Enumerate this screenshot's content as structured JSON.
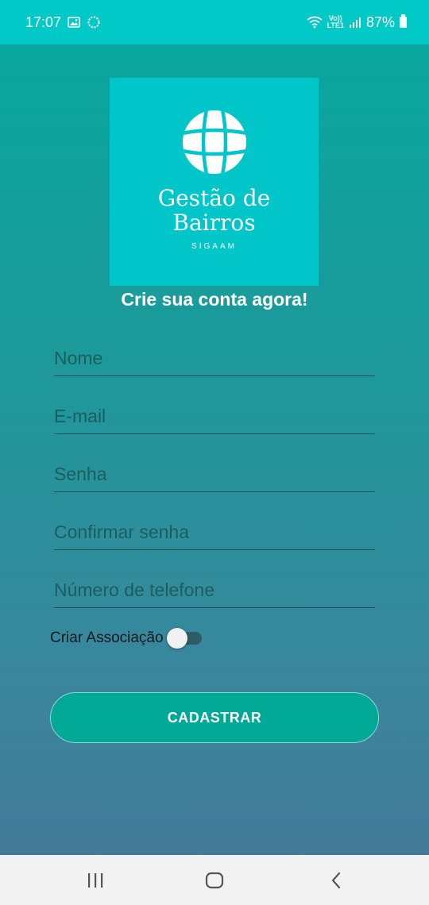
{
  "status_bar": {
    "time": "17:07",
    "lte_top": "Vo))",
    "lte_bottom": "LTE1",
    "battery": "87%",
    "icons": [
      "gallery-icon",
      "sync-icon",
      "wifi-icon",
      "signal-icon",
      "battery-icon"
    ]
  },
  "logo": {
    "title_line1": "Gestão de",
    "title_line2": "Bairros",
    "subtitle": "SIGAAM",
    "icon": "globe-icon"
  },
  "page": {
    "title": "Crie sua conta agora!"
  },
  "form": {
    "name_placeholder": "Nome",
    "email_placeholder": "E-mail",
    "password_placeholder": "Senha",
    "confirm_placeholder": "Confirmar senha",
    "phone_placeholder": "Número de telefone",
    "toggle_label": "Criar Associação",
    "toggle_on": false,
    "submit_label": "CADASTRAR"
  },
  "colors": {
    "status_bar": "#00c9c7",
    "logo_bg": "#00c5c9",
    "button": "#00a896",
    "gradient_top": "#06a89e",
    "gradient_bottom": "#467798"
  },
  "nav": {
    "icons": [
      "recent-apps-icon",
      "home-icon",
      "back-icon"
    ]
  }
}
